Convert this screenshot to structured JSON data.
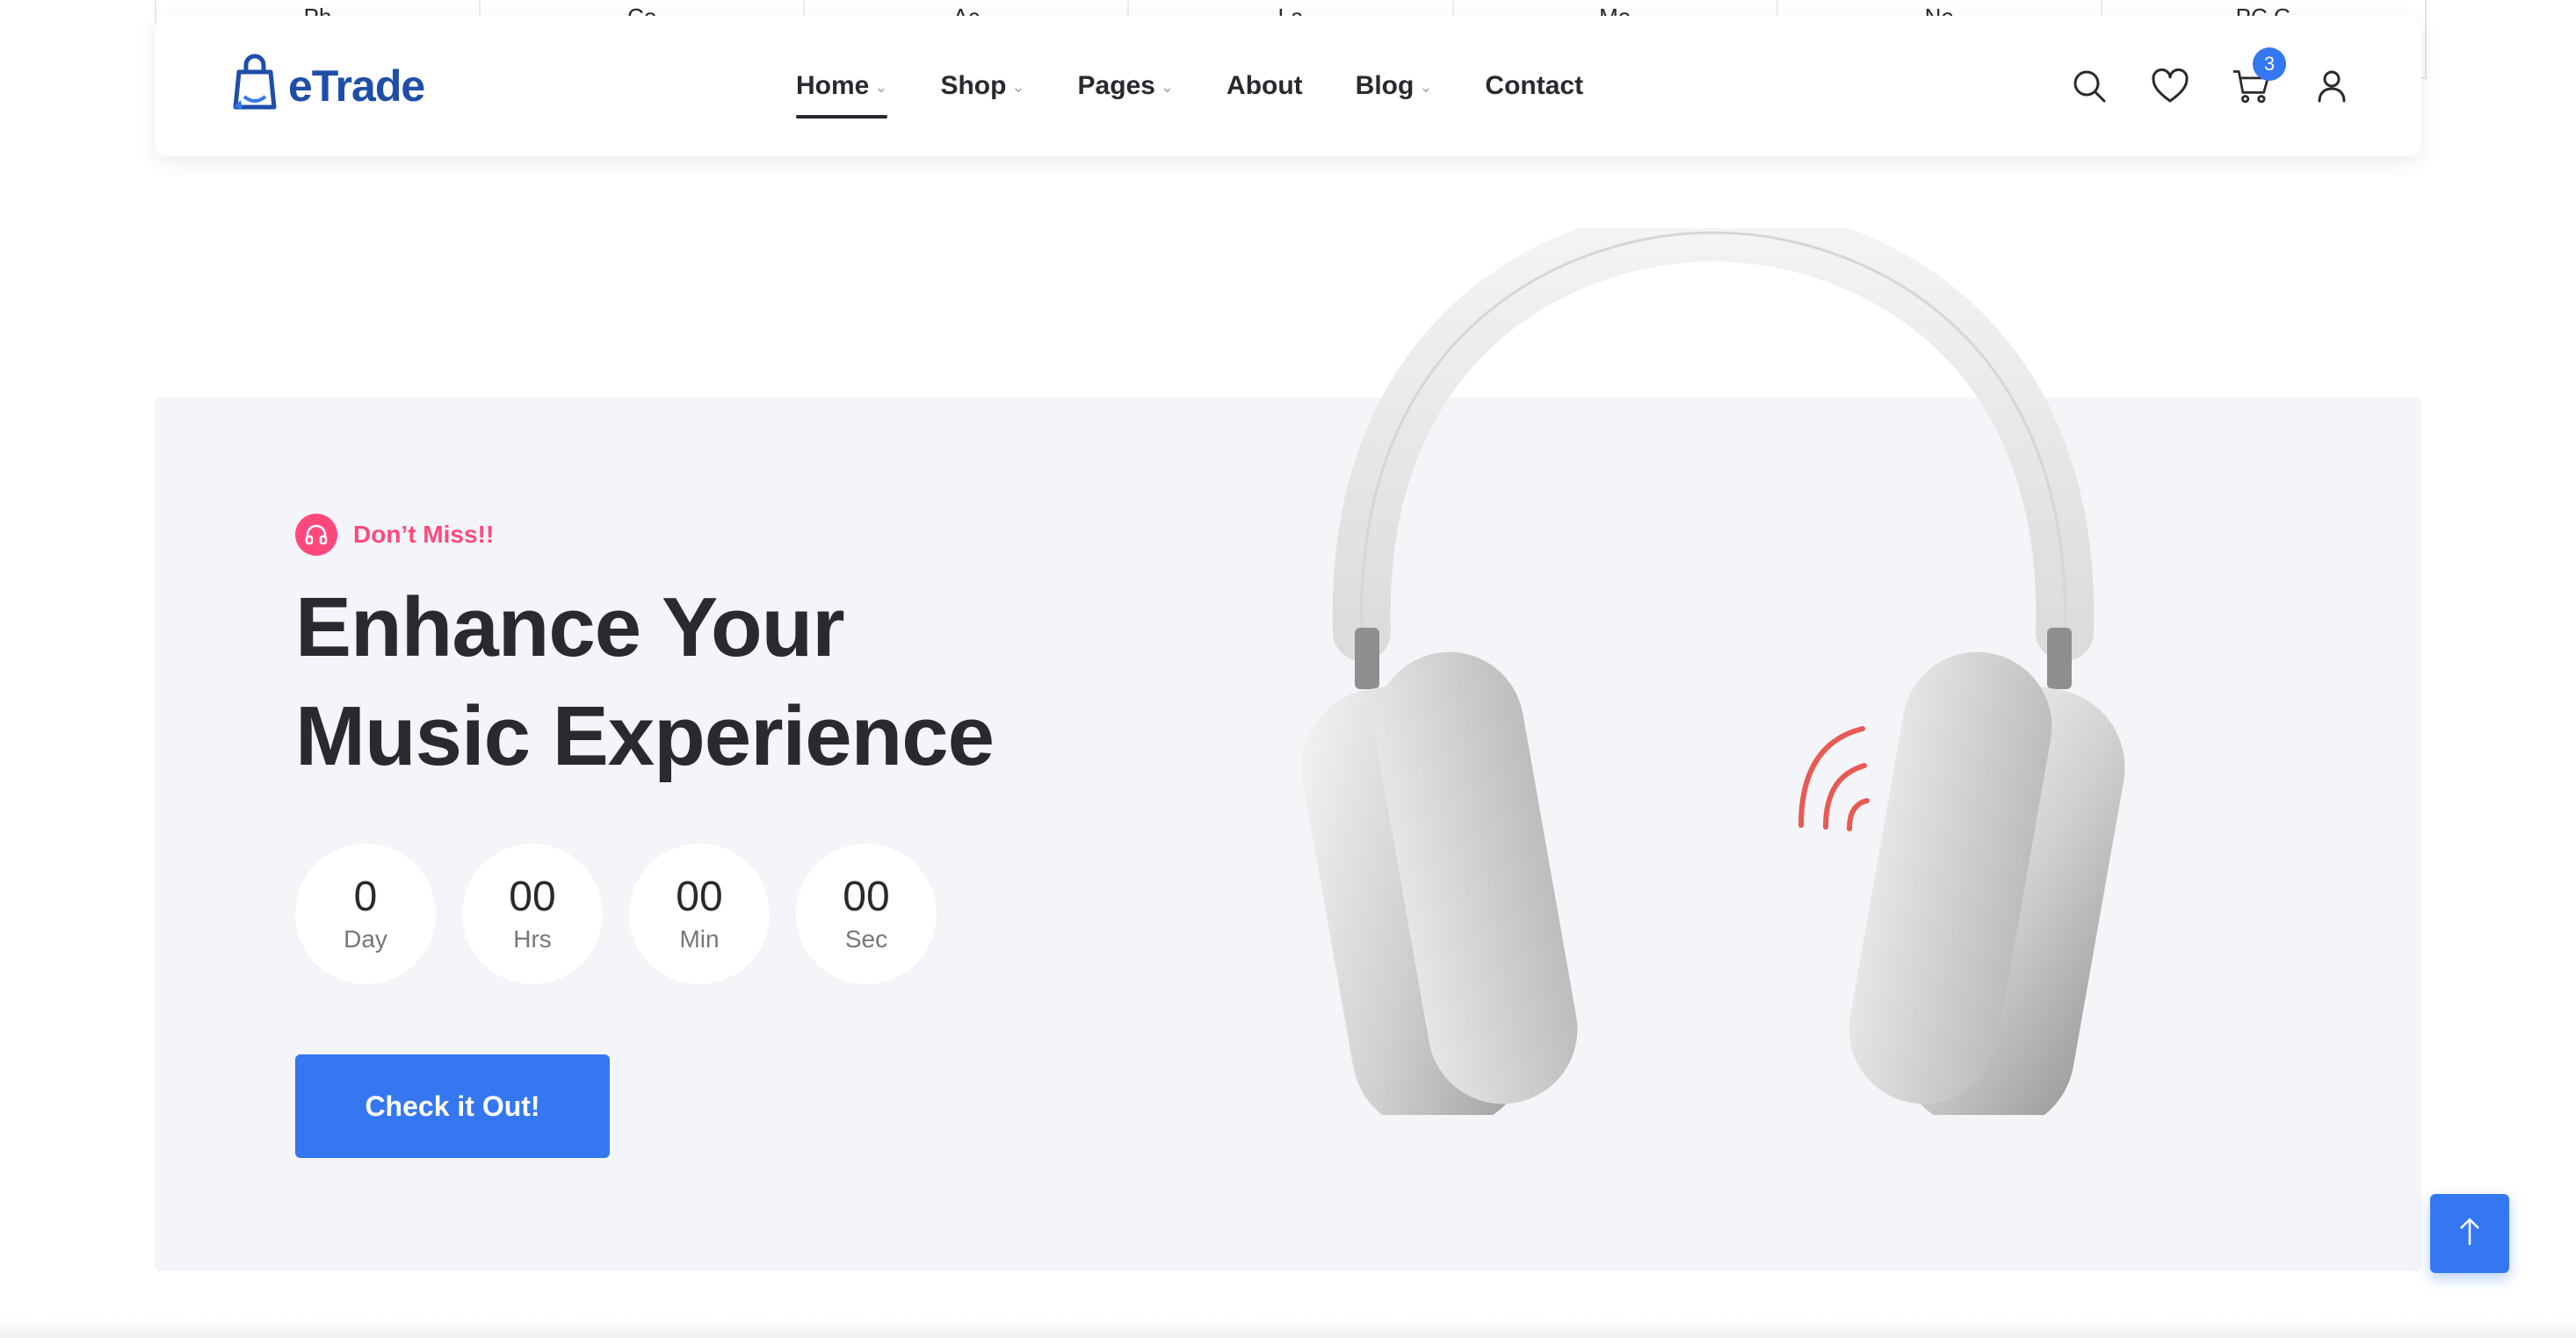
{
  "category_strip": {
    "items": [
      "Ph",
      "Co",
      "Ac",
      "La",
      "Mo",
      "Ne",
      "PC G"
    ]
  },
  "header": {
    "logo_text": "eTrade",
    "nav": [
      {
        "label": "Home",
        "has_dropdown": true,
        "active": true
      },
      {
        "label": "Shop",
        "has_dropdown": true
      },
      {
        "label": "Pages",
        "has_dropdown": true
      },
      {
        "label": "About",
        "has_dropdown": false
      },
      {
        "label": "Blog",
        "has_dropdown": true
      },
      {
        "label": "Contact",
        "has_dropdown": false
      }
    ],
    "icons": [
      "search-icon",
      "heart-icon",
      "cart-icon",
      "user-icon"
    ],
    "cart_count": "3"
  },
  "hero": {
    "tag": "Don’t Miss!!",
    "headline_line1": "Enhance Your",
    "headline_line2": "Music Experience",
    "countdown": [
      {
        "value": "0",
        "label": "Day"
      },
      {
        "value": "00",
        "label": "Hrs"
      },
      {
        "value": "00",
        "label": "Min"
      },
      {
        "value": "00",
        "label": "Sec"
      }
    ],
    "cta_label": "Check it Out!",
    "product": "headphones-image"
  },
  "colors": {
    "primary": "#3577f0",
    "accent": "#ff497c",
    "text": "#292930",
    "hero_bg": "#f4f5f9"
  }
}
